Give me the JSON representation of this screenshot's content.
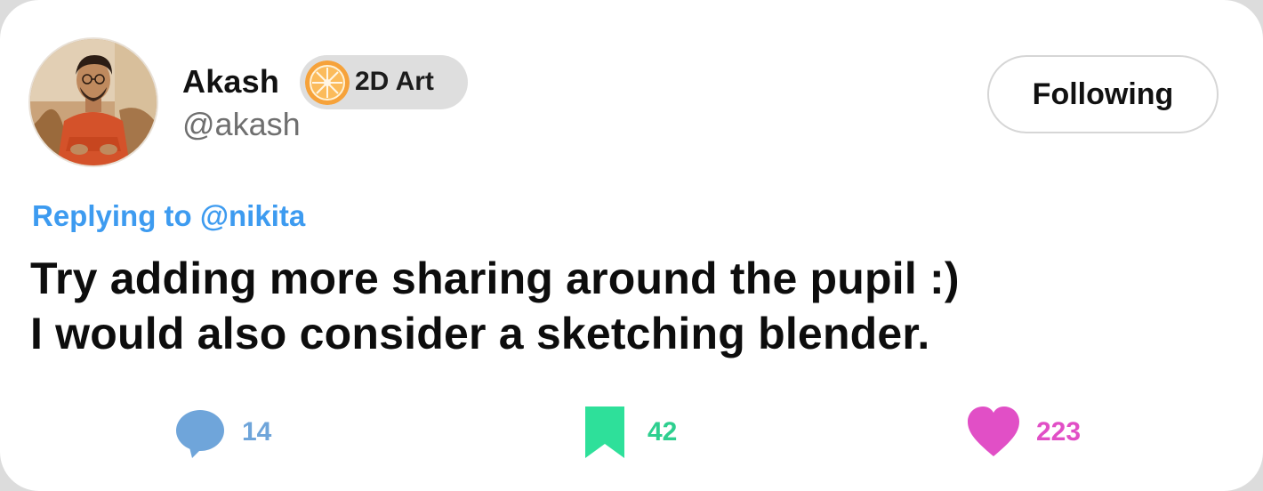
{
  "post": {
    "author": {
      "name": "Akash",
      "handle": "@akash",
      "avatar": "avatar"
    },
    "badge": {
      "icon": "orange-slice-icon",
      "label": "2D Art"
    },
    "follow_button": {
      "label": "Following"
    },
    "reply": {
      "prefix": "Replying to ",
      "mention": "@nikita"
    },
    "text_lines": [
      "Try adding more sharing around the pupil :)",
      "I would also consider a sketching blender."
    ],
    "actions": {
      "comments": {
        "icon": "comment-icon",
        "count": "14",
        "color": "#6fa5da"
      },
      "bookmarks": {
        "icon": "bookmark-icon",
        "count": "42",
        "color": "#2ecf8f"
      },
      "likes": {
        "icon": "heart-icon",
        "count": "223",
        "color": "#e14fc6"
      }
    },
    "colors": {
      "mention": "#3d9bf0",
      "text": "#0d0d0d",
      "handle": "#6f6f6f"
    }
  }
}
